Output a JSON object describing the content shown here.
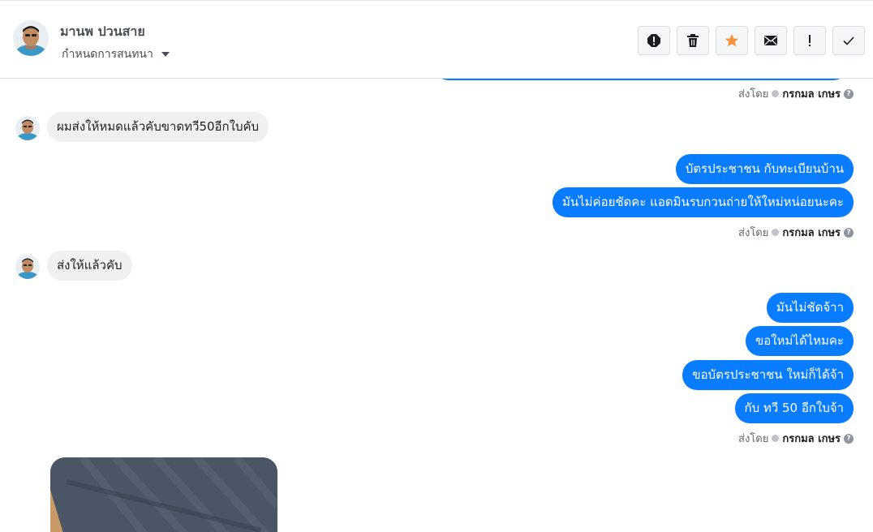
{
  "header": {
    "contact_name": "มานพ ปวนสาย",
    "assign_label": "กำหนดการสนทนา",
    "actions": [
      {
        "name": "spam-icon"
      },
      {
        "name": "trash-icon"
      },
      {
        "name": "star-icon",
        "color": "#f7923b"
      },
      {
        "name": "mail-icon"
      },
      {
        "name": "exclamation-icon"
      },
      {
        "name": "checkmark-icon"
      }
    ]
  },
  "messages": {
    "sent_prefix": "ส่งโดย",
    "agent_name": "กรกมล เกษร",
    "help": "?",
    "incoming_1": "ผมส่งให้หมดแล้วคับขาดทวี50อีกใบคับ",
    "outgoing_1a": "บัตรประชาชน กับทะเบียนบ้าน",
    "outgoing_1b": "มันไม่ค่อยชัดคะ แอดมินรบกวนถ่ายให้ใหม่หน่อยนะคะ",
    "incoming_2": "ส่งให้แล้วคับ",
    "outgoing_2a": "มันไม่ชัดจ้าา",
    "outgoing_2b": "ขอใหม่ได้ไหมคะ",
    "outgoing_2c": "ขอบัตรประชาชน ใหม่ก็ได้จ้า",
    "outgoing_2d": "กับ ทวี 50 อีกใบจ้า"
  },
  "colors": {
    "outgoing_bubble": "#0a7cff",
    "incoming_bubble": "#f0f0f0",
    "star": "#f7923b"
  }
}
